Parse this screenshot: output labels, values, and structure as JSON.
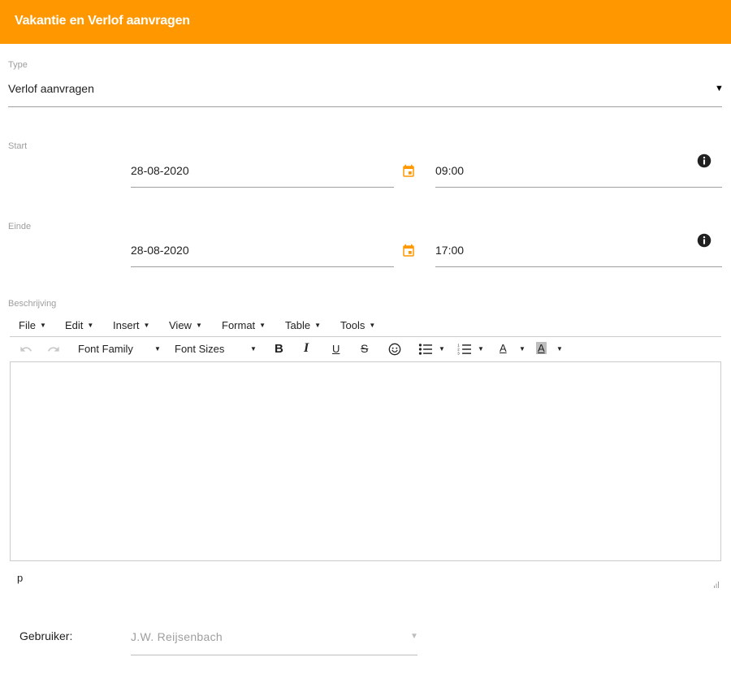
{
  "header": {
    "title": "Vakantie en Verlof aanvragen"
  },
  "type_field": {
    "label": "Type",
    "value": "Verlof aanvragen",
    "arrow": "▼"
  },
  "start": {
    "label": "Start",
    "date": "28-08-2020",
    "time": "09:00"
  },
  "end": {
    "label": "Einde",
    "date": "28-08-2020",
    "time": "17:00"
  },
  "description": {
    "label": "Beschrijving",
    "menu": [
      "File",
      "Edit",
      "Insert",
      "View",
      "Format",
      "Table",
      "Tools"
    ],
    "font_family": "Font Family",
    "font_sizes": "Font Sizes",
    "status_path": "p"
  },
  "user": {
    "label": "Gebruiker:",
    "value": "J.W. Reijsenbach",
    "arrow": "▼"
  },
  "colors": {
    "accent": "#ff9800",
    "icon_dark": "#212121"
  },
  "icons": {
    "calendar": "calendar-icon",
    "info": "info-icon",
    "undo": "undo-icon",
    "redo": "redo-icon"
  }
}
